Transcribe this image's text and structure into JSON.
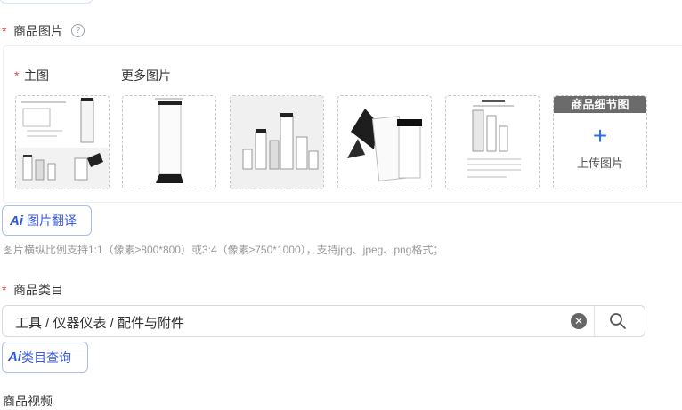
{
  "images_section": {
    "label": "商品图片",
    "help_icon": "question-circle-icon",
    "main_label": "主图",
    "more_label": "更多图片",
    "upload": {
      "header": "商品细节图",
      "plus": "+",
      "text": "上传图片"
    },
    "ai_translate": {
      "badge": "Ai",
      "text": "图片翻译"
    },
    "hint": "图片横纵比例支持1:1（像素≥800*800）或3:4（像素≥750*1000），支持jpg、jpeg、png格式；"
  },
  "category_section": {
    "label": "商品类目",
    "value": "工具 / 仪器仪表 / 配件与附件",
    "clear_icon": "clear-circle-icon",
    "search_icon": "search-icon",
    "ai_query": {
      "badge": "Ai",
      "text": "类目查询"
    }
  },
  "video_section": {
    "label": "商品视频"
  },
  "required_mark": "*",
  "colors": {
    "accent": "#2b6cf5",
    "required": "#e5484d",
    "upload_header": "#6b6b6b"
  }
}
